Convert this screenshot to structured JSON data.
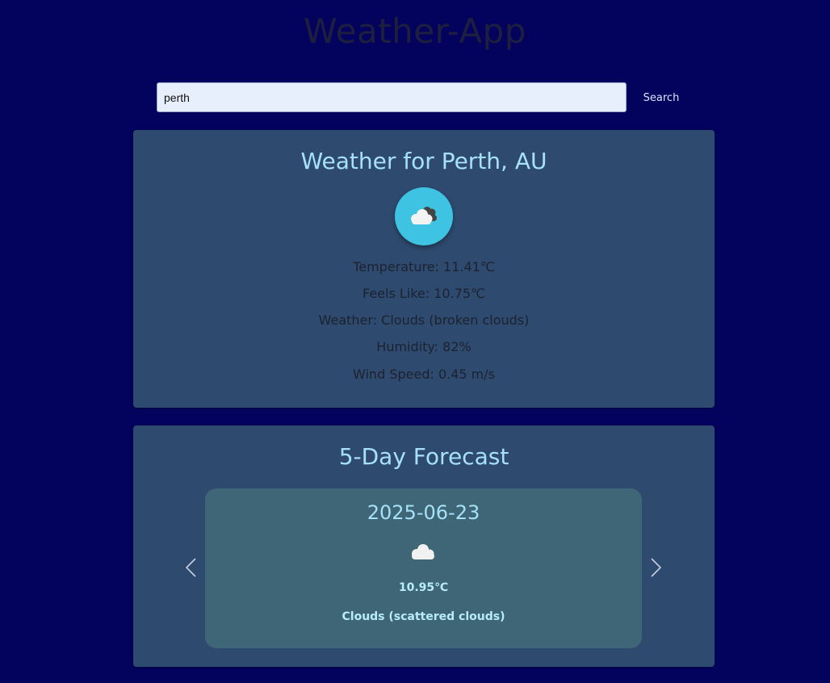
{
  "app": {
    "title": "Weather-App"
  },
  "search": {
    "value": "perth",
    "button_label": "Search"
  },
  "current": {
    "title": "Weather for Perth, AU",
    "icon": "broken-clouds-icon",
    "temperature": "Temperature: 11.41℃",
    "feels_like": "Feels Like: 10.75℃",
    "weather": "Weather: Clouds (broken clouds)",
    "humidity": "Humidity: 82%",
    "wind": "Wind Speed: 0.45 m/s"
  },
  "forecast": {
    "title": "5-Day Forecast",
    "prev_icon": "chevron-left-icon",
    "next_icon": "chevron-right-icon",
    "items": [
      {
        "date": "2025-06-23",
        "icon": "scattered-clouds-icon",
        "temp": "10.95℃",
        "description": "Clouds (scattered clouds)"
      }
    ]
  },
  "colors": {
    "background": "#03035e",
    "card": "#2e4a6e",
    "forecast_item": "#3f6677",
    "accent_text": "#a6e1f8",
    "icon_circle": "#3ec3e2"
  }
}
